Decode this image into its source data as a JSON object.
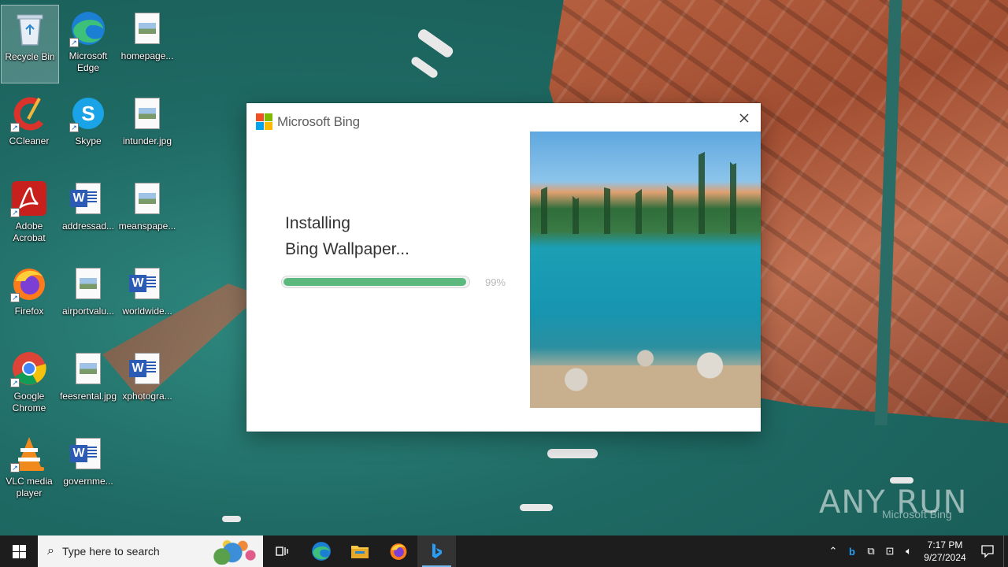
{
  "desktop": {
    "icons": [
      {
        "label": "Recycle Bin",
        "icon": "recycle-bin-icon"
      },
      {
        "label": "Microsoft Edge",
        "icon": "edge-icon"
      },
      {
        "label": "homepage...",
        "icon": "image-file-icon"
      },
      {
        "label": "CCleaner",
        "icon": "ccleaner-icon"
      },
      {
        "label": "Skype",
        "icon": "skype-icon"
      },
      {
        "label": "intunder.jpg",
        "icon": "image-file-icon"
      },
      {
        "label": "Adobe Acrobat",
        "icon": "acrobat-icon"
      },
      {
        "label": "addressad...",
        "icon": "word-file-icon"
      },
      {
        "label": "meanspape...",
        "icon": "image-file-icon"
      },
      {
        "label": "Firefox",
        "icon": "firefox-icon"
      },
      {
        "label": "airportvalu...",
        "icon": "image-file-icon"
      },
      {
        "label": "worldwide...",
        "icon": "word-file-icon"
      },
      {
        "label": "Google Chrome",
        "icon": "chrome-icon"
      },
      {
        "label": "feesrental.jpg",
        "icon": "image-file-icon"
      },
      {
        "label": "xphotogra...",
        "icon": "word-file-icon"
      },
      {
        "label": "VLC media player",
        "icon": "vlc-icon"
      },
      {
        "label": "governme...",
        "icon": "word-file-icon"
      }
    ]
  },
  "dialog": {
    "brand": "Microsoft Bing",
    "title_line1": "Installing",
    "title_line2": "Bing Wallpaper...",
    "progress": 0.99,
    "progress_label": "99%",
    "close_icon": "close-icon",
    "colors": {
      "progress": "#5cb97e",
      "ms_red": "#f25022",
      "ms_green": "#7fba00",
      "ms_blue": "#00a4ef",
      "ms_yellow": "#ffb900"
    }
  },
  "watermark": {
    "text": "ANY RUN",
    "sub": "Microsoft Bing"
  },
  "taskbar": {
    "search_placeholder": "Type here to search",
    "apps": [
      "task-view-icon",
      "edge-icon",
      "file-explorer-icon",
      "firefox-icon",
      "bing-icon"
    ],
    "time": "7:17 PM",
    "date": "9/27/2024"
  }
}
